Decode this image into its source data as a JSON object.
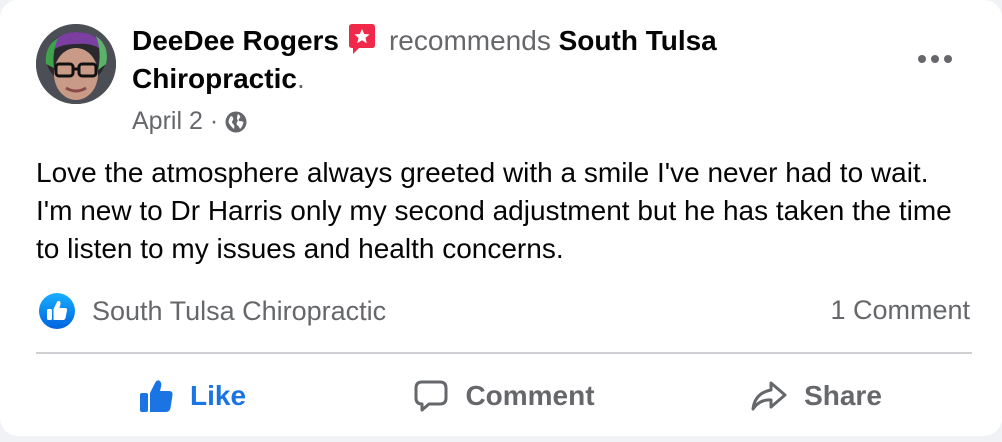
{
  "post": {
    "author": "DeeDee Rogers",
    "action_word": "recommends",
    "page_name": "South Tulsa Chiropractic",
    "period": ".",
    "date": "April 2",
    "separator": "·",
    "privacy_icon": "globe-icon",
    "more_icon": "ellipsis-icon",
    "recommend_icon": "recommend-star-icon",
    "body": "Love the atmosphere always greeted with a smile I've never had to wait. I'm new to Dr Harris only my second adjustment but he has taken the time to listen to my issues and health concerns."
  },
  "reactions": {
    "icon": "like-badge-icon",
    "names": "South Tulsa Chiropractic",
    "comment_count": "1 Comment"
  },
  "actions": {
    "like": {
      "label": "Like",
      "icon": "thumbs-up-icon"
    },
    "comment": {
      "label": "Comment",
      "icon": "comment-bubble-icon"
    },
    "share": {
      "label": "Share",
      "icon": "share-arrow-icon"
    }
  },
  "colors": {
    "accent": "#1b74e4",
    "recommend": "#f02849",
    "secondary_text": "#65676b",
    "primary_text": "#050505"
  }
}
